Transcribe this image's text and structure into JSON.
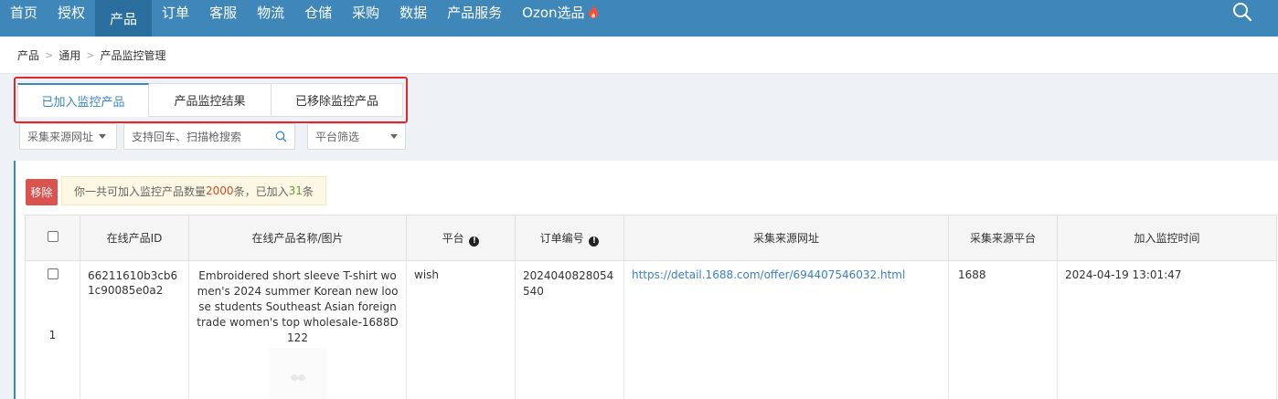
{
  "nav": {
    "items": [
      {
        "label": "首页"
      },
      {
        "label": "授权"
      },
      {
        "label": "产品",
        "active": true
      },
      {
        "label": "订单"
      },
      {
        "label": "客服"
      },
      {
        "label": "物流"
      },
      {
        "label": "仓储"
      },
      {
        "label": "采购"
      },
      {
        "label": "数据"
      },
      {
        "label": "产品服务"
      },
      {
        "label": "Ozon选品",
        "icon": "fire-icon"
      }
    ],
    "search_icon": "search-icon"
  },
  "breadcrumb": [
    "产品",
    "通用",
    "产品监控管理"
  ],
  "tabs": [
    {
      "label": "已加入监控产品",
      "active": true
    },
    {
      "label": "产品监控结果"
    },
    {
      "label": "已移除监控产品"
    }
  ],
  "filters": {
    "source_url": "采集来源网址",
    "search_placeholder": "支持回车、扫描枪搜索",
    "platform": "平台筛选"
  },
  "actions": {
    "remove_label": "移除"
  },
  "notice": {
    "prefix": "你一共可加入监控产品数量",
    "limit": "2000",
    "middle": "条，已加入",
    "added": "31",
    "suffix": "条"
  },
  "table": {
    "headers": [
      "在线产品ID",
      "在线产品名称/图片",
      "平台",
      "订单编号",
      "采集来源网址",
      "采集来源平台",
      "加入监控时间"
    ],
    "rows": [
      {
        "index": "1",
        "product_id": "66211610b3cb61c90085e0a2",
        "name": "Embroidered short sleeve T-shirt women's 2024 summer Korean new loose students Southeast Asian foreign trade women's top wholesale-1688D122",
        "platform": "wish",
        "order_no": "2024040828054540",
        "source_url": "https://detail.1688.com/offer/694407546032.html",
        "source_platform": "1688",
        "added_time": "2024-04-19 13:01:47"
      }
    ]
  },
  "colors": {
    "nav_bg": "#3f87b8",
    "accent": "#3a87c5",
    "danger": "#d9534f",
    "highlight_box": "#e0272c"
  }
}
